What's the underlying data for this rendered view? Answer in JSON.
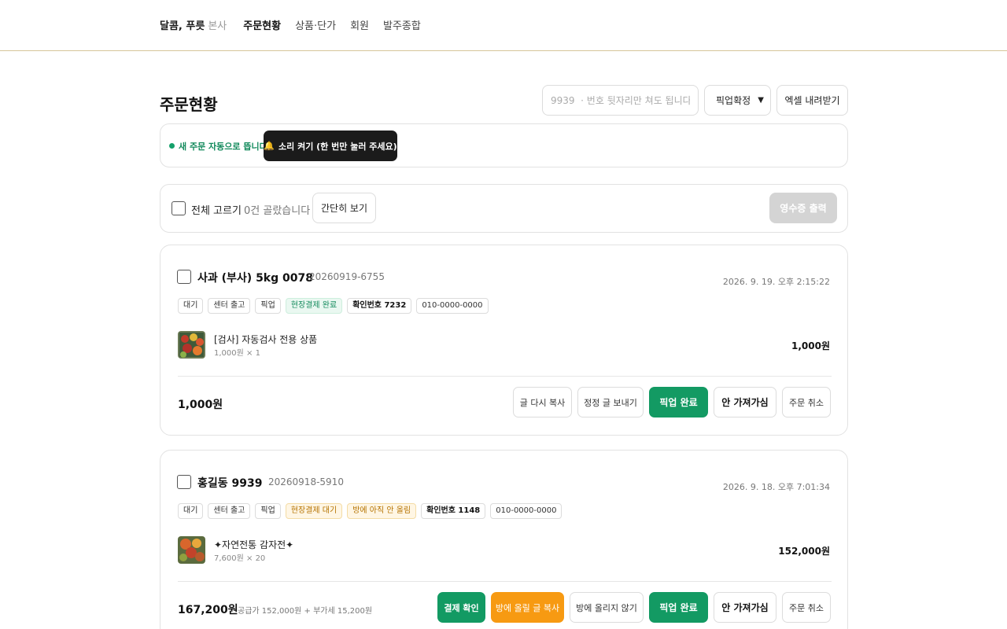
{
  "topbar": {
    "brand": "달콤, 푸릇",
    "brand_sub": "본사",
    "nav": [
      {
        "label": "주문현황"
      },
      {
        "label": "상품·단가"
      },
      {
        "label": "회원"
      },
      {
        "label": "발주종합"
      }
    ]
  },
  "page": {
    "title": "주문현황",
    "search_placeholder": "9939  · 번호 뒷자리만 쳐도 됩니다",
    "filter_value": "픽업확정",
    "excel_label": "엑셀 내려받기"
  },
  "notice": {
    "live_text": "새 주문 자동으로 뜹니다",
    "sound_label": "소리 켜기 (한 번만 눌러 주세요)"
  },
  "toolbar": {
    "select_all": "전체 고르기",
    "selected_count": "0건 골랐습니다",
    "simple_view": "간단히 보기",
    "receipt": "영수증 출력"
  },
  "orders": [
    {
      "name": "사과 (부사) 5kg 0078",
      "order_no": "20260919-6755",
      "time": "2026. 9. 19. 오후 2:15:22",
      "tags": [
        {
          "label": "대기",
          "style": "plain"
        },
        {
          "label": "센터 출고",
          "style": "plain"
        },
        {
          "label": "픽업",
          "style": "plain"
        },
        {
          "label": "현장결제 완료",
          "style": "green"
        },
        {
          "label": "확인번호 7232",
          "style": "bold"
        },
        {
          "label": "010-0000-0000",
          "style": "plain"
        }
      ],
      "item": {
        "name": "[검사] 자동검사 전용 상품",
        "sub": "1,000원 × 1",
        "amount": "1,000원"
      },
      "total": "1,000원",
      "total_sub": "",
      "actions": [
        {
          "label": "글 다시 복사",
          "style": "outline"
        },
        {
          "label": "정정 글 보내기",
          "style": "outline"
        },
        {
          "label": "픽업 완료",
          "style": "green"
        },
        {
          "label": "안 가져가심",
          "style": "dark-outline"
        },
        {
          "label": "주문 취소",
          "style": "outline"
        }
      ]
    },
    {
      "name": "홍길동 9939",
      "order_no": "20260918-5910",
      "time": "2026. 9. 18. 오후 7:01:34",
      "tags": [
        {
          "label": "대기",
          "style": "plain"
        },
        {
          "label": "센터 출고",
          "style": "plain"
        },
        {
          "label": "픽업",
          "style": "plain"
        },
        {
          "label": "현장결제 대기",
          "style": "amber"
        },
        {
          "label": "방에 아직 안 올림",
          "style": "amber"
        },
        {
          "label": "확인번호 1148",
          "style": "bold"
        },
        {
          "label": "010-0000-0000",
          "style": "plain"
        }
      ],
      "item": {
        "name": "✦자연전통 감자전✦",
        "sub": "7,600원 × 20",
        "amount": "152,000원"
      },
      "total": "167,200원",
      "total_sub": "공급가 152,000원 + 부가세 15,200원",
      "actions": [
        {
          "label": "결제 확인",
          "style": "green"
        },
        {
          "label": "방에 올릴 글 복사",
          "style": "orange"
        },
        {
          "label": "방에 올리지 않기",
          "style": "outline"
        },
        {
          "label": "픽업 완료",
          "style": "green"
        },
        {
          "label": "안 가져가심",
          "style": "dark-outline"
        },
        {
          "label": "주문 취소",
          "style": "outline"
        }
      ]
    }
  ],
  "colors": {
    "accent_green": "#139a63",
    "orange": "#f79a12",
    "dark": "#1b1b1b",
    "header_rule": "#d6c59a"
  }
}
